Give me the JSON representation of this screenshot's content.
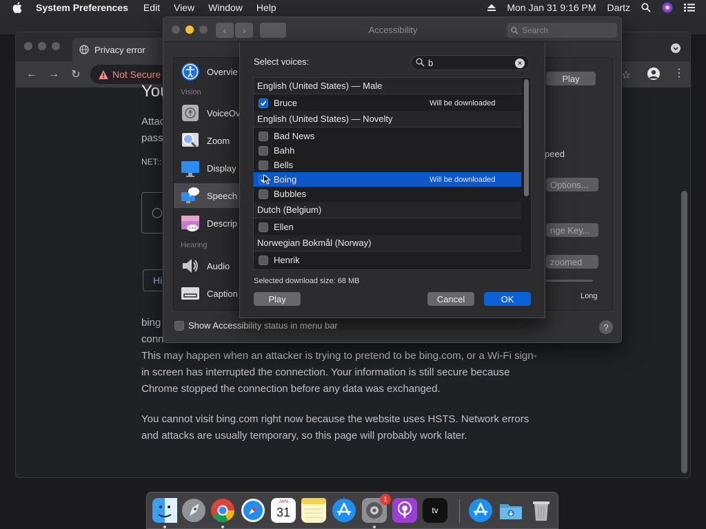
{
  "menubar": {
    "app_name": "System Preferences",
    "menus": [
      "Edit",
      "View",
      "Window",
      "Help"
    ],
    "datetime": "Mon Jan 31  9:16 PM",
    "user": "Dartz"
  },
  "chrome": {
    "tab_title": "Privacy error",
    "omnibox_label": "Not Secure",
    "heading_fragment": "You",
    "line1_fragment": "Attac",
    "line2_fragment": "pass",
    "error_code_fragment": "NET::",
    "button_fragment": "Hi",
    "para1_l1": "bing",
    "para1_l2": "conn",
    "para1_l3": "This may happen when an attacker is trying to pretend to be bing.com, or a Wi-Fi sign-",
    "para1_l4": "in screen has interrupted the connection. Your information is still secure because",
    "para1_l5": "Chrome stopped the connection before any data was exchanged.",
    "para2_l1": "You cannot visit bing.com right now because the website uses HSTS. Network errors",
    "para2_l2": "and attacks are usually temporary, so this page will probably work later."
  },
  "syspref": {
    "title": "Accessibility",
    "search_placeholder": "Search",
    "sidebar": {
      "items": [
        {
          "label": "Overvie",
          "icon": "accessibility-icon"
        },
        {
          "label": "VoiceOv",
          "icon": "voiceover-icon"
        },
        {
          "label": "Zoom",
          "icon": "zoom-icon"
        },
        {
          "label": "Display",
          "icon": "display-icon"
        },
        {
          "label": "Speech",
          "icon": "speech-icon"
        },
        {
          "label": "Descrip",
          "icon": "descriptions-icon"
        },
        {
          "label": "Audio",
          "icon": "audio-icon"
        },
        {
          "label": "Caption",
          "icon": "captions-icon"
        }
      ],
      "section_vision": "Vision",
      "section_hearing": "Hearing"
    },
    "right_panel": {
      "play_label": "Play",
      "speed_fragment": "peed",
      "options_fragment": "Options...",
      "change_key_fragment": "nge Key...",
      "zoomed_fragment": "zoomed",
      "long_label": "Long"
    },
    "status_checkbox_label": "Show Accessibility status in menu bar",
    "help_label": "?"
  },
  "voice_sheet": {
    "title": "Select voices:",
    "search_value": "b",
    "groups": [
      {
        "header": "English (United States) — Male",
        "voices": [
          {
            "name": "Bruce",
            "checked": true,
            "status": "Will be downloaded",
            "selected": false
          }
        ]
      },
      {
        "header": "English (United States) — Novelty",
        "voices": [
          {
            "name": "Bad News",
            "checked": false,
            "status": "",
            "selected": false
          },
          {
            "name": "Bahh",
            "checked": false,
            "status": "",
            "selected": false
          },
          {
            "name": "Bells",
            "checked": false,
            "status": "",
            "selected": false
          },
          {
            "name": "Boing",
            "checked": true,
            "status": "Will be downloaded",
            "selected": true
          },
          {
            "name": "Bubbles",
            "checked": false,
            "status": "",
            "selected": false
          }
        ]
      },
      {
        "header": "Dutch (Belgium)",
        "voices": [
          {
            "name": "Ellen",
            "checked": false,
            "status": "",
            "selected": false
          }
        ]
      },
      {
        "header": "Norwegian Bokmål (Norway)",
        "voices": [
          {
            "name": "Henrik",
            "checked": false,
            "status": "",
            "selected": false
          }
        ]
      }
    ],
    "download_size": "Selected download size: 68 MB",
    "play_label": "Play",
    "cancel_label": "Cancel",
    "ok_label": "OK"
  },
  "dock": {
    "calendar_month": "JAN",
    "calendar_day": "31",
    "sysprefs_badge": "1",
    "tv_label": "tv"
  },
  "colors": {
    "accent": "#0a62d8",
    "selection": "#0a58ca",
    "warning": "#f28b82"
  }
}
